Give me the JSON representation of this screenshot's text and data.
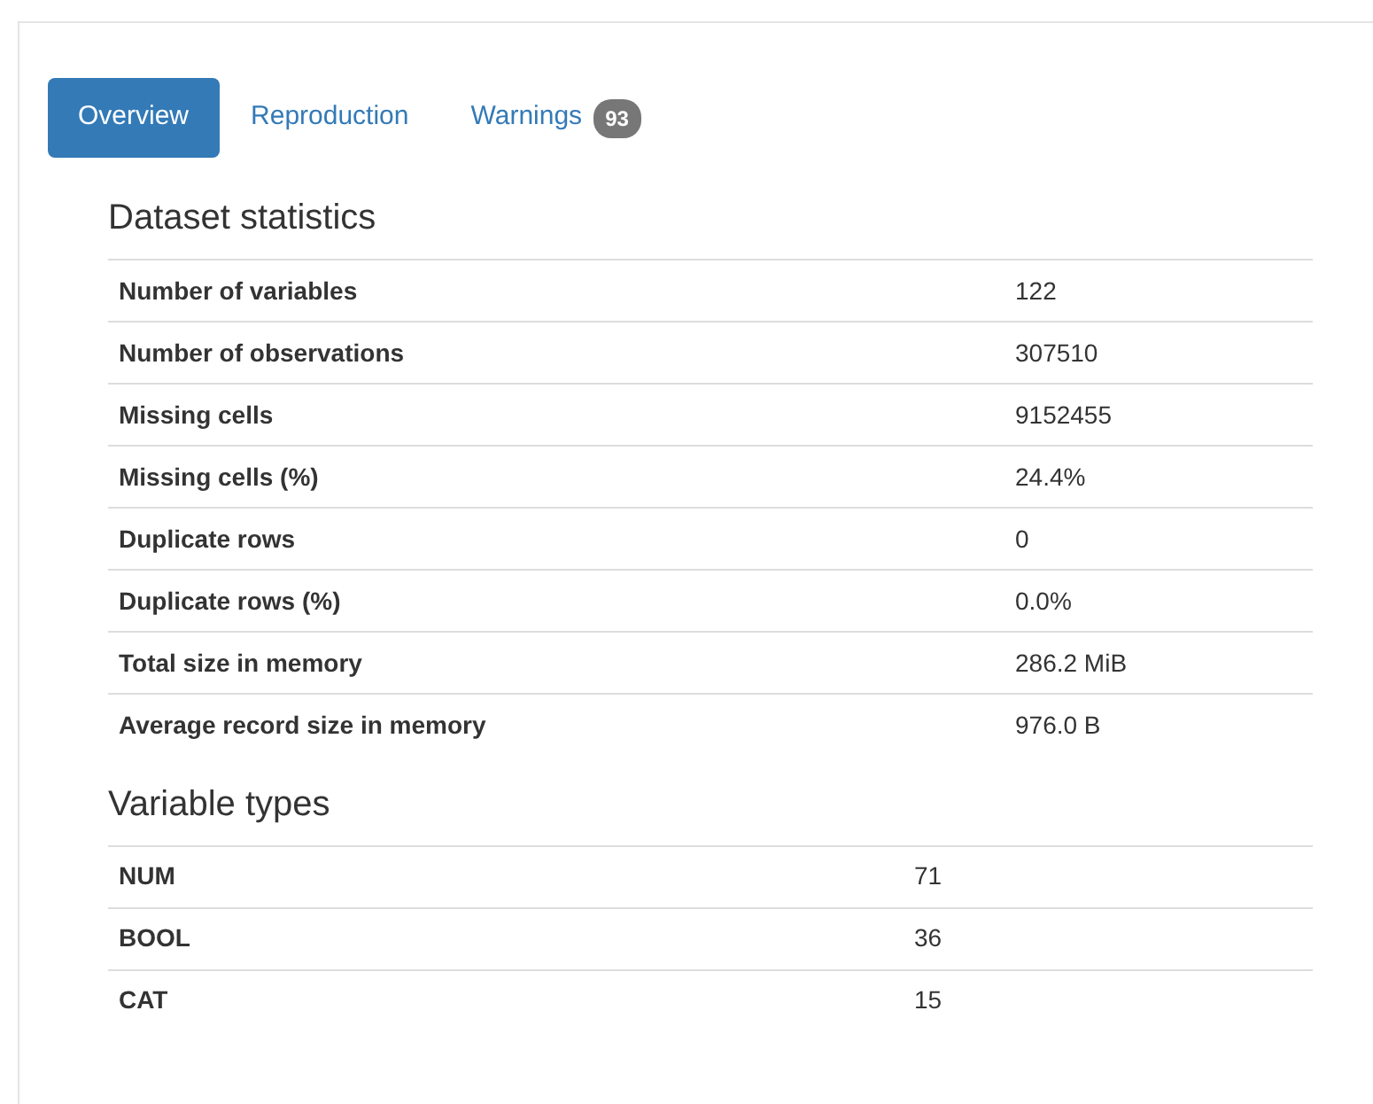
{
  "tabs": [
    {
      "label": "Overview",
      "selected": true
    },
    {
      "label": "Reproduction",
      "selected": false
    },
    {
      "label": "Warnings",
      "badge": "93",
      "selected": false
    }
  ],
  "sections": [
    {
      "title": "Dataset statistics",
      "rows": [
        {
          "label": "Number of variables",
          "value": "122"
        },
        {
          "label": "Number of observations",
          "value": "307510"
        },
        {
          "label": "Missing cells",
          "value": "9152455"
        },
        {
          "label": "Missing cells (%)",
          "value": "24.4%"
        },
        {
          "label": "Duplicate rows",
          "value": "0"
        },
        {
          "label": "Duplicate rows (%)",
          "value": "0.0%"
        },
        {
          "label": "Total size in memory",
          "value": "286.2 MiB"
        },
        {
          "label": "Average record size in memory",
          "value": "976.0 B"
        }
      ]
    },
    {
      "title": "Variable types",
      "rows": [
        {
          "label": "NUM",
          "value": "71"
        },
        {
          "label": "BOOL",
          "value": "36"
        },
        {
          "label": "CAT",
          "value": "15"
        }
      ]
    }
  ]
}
